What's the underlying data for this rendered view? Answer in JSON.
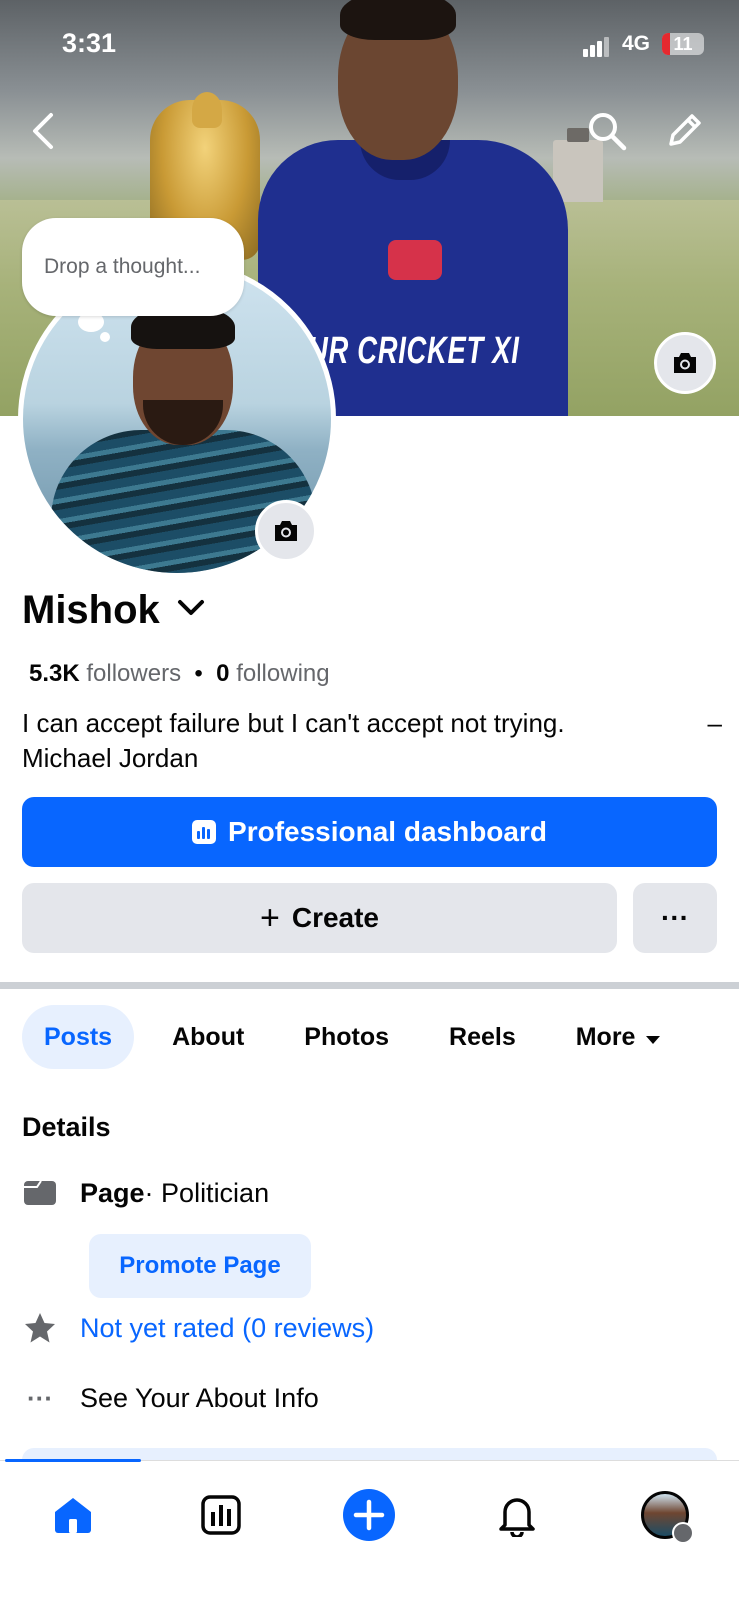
{
  "status_bar": {
    "time": "3:31",
    "network": "4G",
    "battery": "11"
  },
  "cover": {
    "shirt_text": "UR CRICKET XI"
  },
  "thought_bubble": {
    "placeholder": "Drop a thought..."
  },
  "profile": {
    "name": "Mishok",
    "followers_count": "5.3K",
    "followers_label": "followers",
    "separator": "•",
    "following_count": "0",
    "following_label": "following",
    "bio_line1": "I can accept failure but I can't accept not trying.",
    "bio_dash": "–",
    "bio_line2": "Michael Jordan"
  },
  "actions": {
    "dashboard_label": "Professional dashboard",
    "create_label": "Create",
    "create_icon": "+",
    "more_label": "···"
  },
  "tabs": [
    {
      "label": "Posts",
      "active": true
    },
    {
      "label": "About"
    },
    {
      "label": "Photos"
    },
    {
      "label": "Reels"
    },
    {
      "label": "More"
    }
  ],
  "details": {
    "title": "Details",
    "page_label": "Page",
    "page_category": " · Politician",
    "promote_label": "Promote Page",
    "rating_label": "Not yet rated (0 reviews)",
    "about_label": "See Your About Info",
    "about_icon": "···"
  },
  "colors": {
    "primary": "#0866ff",
    "tab_active_bg": "#e7f0fe",
    "button_gray": "#e4e6eb"
  },
  "icons": [
    "back-icon",
    "search-icon",
    "edit-icon",
    "camera-icon",
    "dashboard-icon",
    "page-icon",
    "star-icon",
    "home-icon",
    "insights-icon",
    "add-icon",
    "bell-icon"
  ]
}
